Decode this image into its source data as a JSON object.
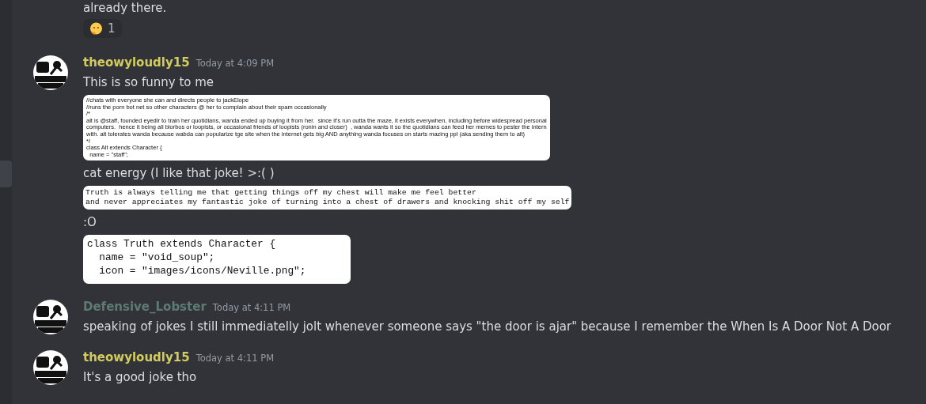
{
  "top_fragment": {
    "text": "already there.",
    "reactions": [
      {
        "count": "1",
        "selected": false
      }
    ]
  },
  "messages": [
    {
      "author": "theowyloudly15",
      "color": "#d2cc5c",
      "time": "Today at 4:09 PM",
      "content": [
        {
          "kind": "text",
          "text": "This is so funny to me"
        },
        {
          "kind": "code_tiny",
          "lines": [
            "//chats with everyone she can and directs people to jackElope",
            "//runs the porn bot net so other characters @ her to complain about their spam occasionally",
            "/*",
            "alt is @staff, founded eyedlr to train her quotidians, wanda ended up buying it from her.  since it's run outta the maze, it exists everywhen, including before widespread personal",
            "computers.  hence it being all blorbos or loopists, or occasional friends of loopists (ronin and closer)  , wanda wants it so the quotidians can feed her memes to pester the intern",
            "with. alt tolerates wanda because wabda can popularize tge site when the internet gets big AND anything wanda focuses on starts mazing ppl (aka sending them to alt)",
            "*/",
            "class Alt extends Character {",
            "  name = \"staff\";"
          ]
        },
        {
          "kind": "text",
          "text": "cat energy (I like that joke! >:( )"
        },
        {
          "kind": "code_small",
          "lines": [
            "Truth is always telling me that getting things off my chest will make me feel better",
            "and never appreciates my fantastic joke of turning into a chest of drawers and knocking shit off my self"
          ]
        },
        {
          "kind": "text",
          "text": ":O"
        },
        {
          "kind": "code_large",
          "lines": [
            "class Truth extends Character {",
            "  name = \"void_soup\";",
            "  icon = \"images/icons/Neville.png\";"
          ]
        }
      ]
    },
    {
      "author": "Defensive_Lobster",
      "color": "#5e7b73",
      "time": "Today at 4:11 PM",
      "content": [
        {
          "kind": "text",
          "text": "speaking of jokes I still immediatelly jolt whenever someone says \"the door is ajar\" because I remember the When Is A Door Not A Door"
        }
      ]
    },
    {
      "author": "theowyloudly15",
      "color": "#d2cc5c",
      "time": "Today at 4:11 PM",
      "content": [
        {
          "kind": "text",
          "text": "It's a good joke tho"
        }
      ]
    }
  ]
}
